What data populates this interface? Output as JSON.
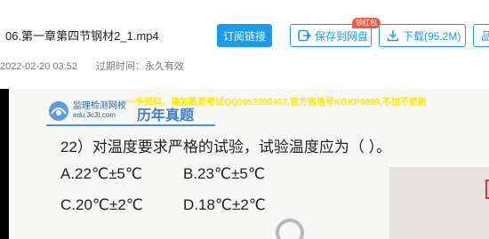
{
  "file": {
    "title": "06.第一章第四节钢材2_1.mp4",
    "date": "2022-02-20 03:52",
    "expire": "过期时间：永久有效"
  },
  "toolbar": {
    "subscribe_label": "订阅链接",
    "save_label": "保存到网盘",
    "save_badge": "领红包",
    "download_label": "下载(95.2M)",
    "more_label": "品"
  },
  "slide": {
    "logo_name": "监理检测网校",
    "logo_site": "edu.3c3t.com",
    "watermark": "一手资料，请加酷哥考试QQ1052290467,官方微信号KGKP8899,不加不更新",
    "section_title": "历年真题",
    "question": "22）对温度要求严格的试验，试验温度应为（    ）。",
    "options": {
      "a": "A.22℃±5℃",
      "b": "B.23℃±5℃",
      "c": "C.20℃±2℃",
      "d": "D.18℃±2℃"
    }
  },
  "colors": {
    "accent": "#1a9bf0",
    "badge": "#f25a44",
    "slide_title": "#3d7fd6",
    "watermark": "#ffe900"
  }
}
